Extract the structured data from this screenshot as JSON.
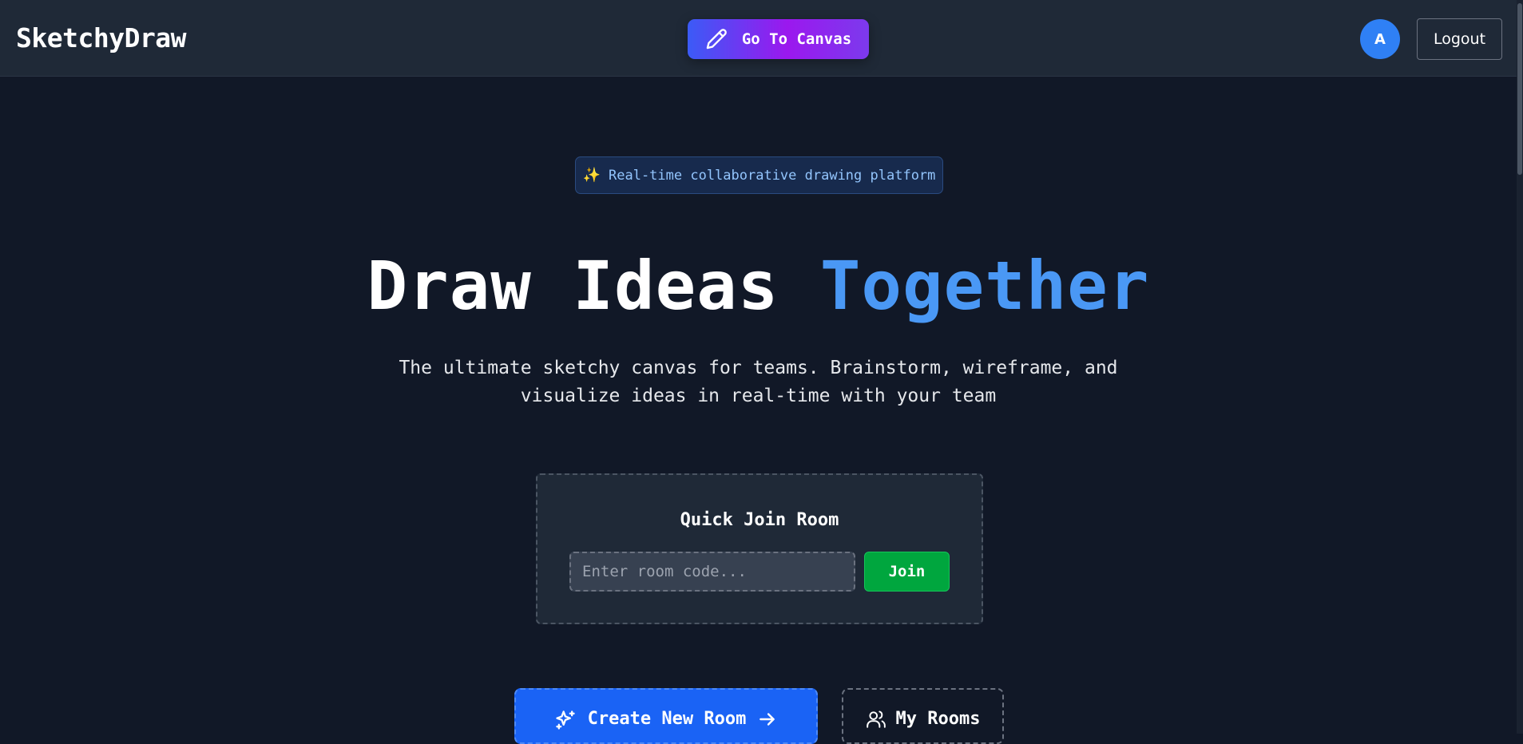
{
  "header": {
    "brand": "SketchyDraw",
    "canvas_button_label": "Go To Canvas",
    "avatar_initial": "A",
    "logout_label": "Logout"
  },
  "hero": {
    "badge_icon": "✨",
    "badge_text": "Real-time collaborative drawing platform",
    "title_part1": "Draw Ideas ",
    "title_accent": "Together",
    "subtitle": "The ultimate sketchy canvas for teams. Brainstorm, wireframe, and visualize ideas in real-time with your team"
  },
  "quick_join": {
    "title": "Quick Join Room",
    "input_value": "",
    "input_placeholder": "Enter room code...",
    "join_label": "Join"
  },
  "actions": {
    "create_label": "Create New Room",
    "my_rooms_label": "My Rooms"
  },
  "icons": {
    "canvas": "pencil-icon",
    "create": "sparkles-icon",
    "create_arrow": "arrow-right-icon",
    "my_rooms": "users-icon"
  },
  "colors": {
    "background": "#111827",
    "navbar": "#1f2937",
    "accent_blue": "#4a98f5",
    "gradient_start": "#3b5bf6",
    "gradient_mid": "#9b18ee",
    "join_green": "#00a63e",
    "create_blue": "#1a63f5",
    "avatar_blue": "#2f80f5"
  }
}
